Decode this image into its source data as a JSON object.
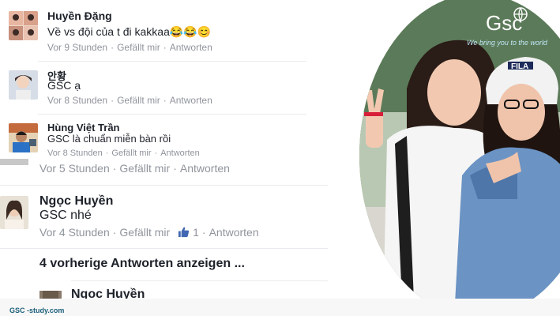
{
  "comments": [
    {
      "name": "Huyền Đặng",
      "text": "Về vs đội của t đi kakkaa",
      "emoji": "😂😂😊",
      "time": "Vor 9 Stunden",
      "like": "Gefällt mir",
      "reply": "Antworten"
    },
    {
      "name": "안황",
      "text": "GSC ạ",
      "time": "Vor 8 Stunden",
      "like": "Gefällt mir",
      "reply": "Antworten"
    },
    {
      "name": "Hùng Việt Trần",
      "text": "GSC là chuẩn miễn bàn rồi",
      "time": "Vor 8 Stunden",
      "like": "Gefällt mir",
      "reply": "Antworten"
    }
  ],
  "parent_meta": {
    "time": "Vor 5 Stunden",
    "like": "Gefällt mir",
    "reply": "Antworten"
  },
  "main_comment": {
    "name": "Ngọc Huyền",
    "text": "GSC nhé",
    "time": "Vor 4 Stunden",
    "like": "Gefällt mir",
    "like_count": "1",
    "reply": "Antworten"
  },
  "show_previous": "4 vorherige Antworten anzeigen ...",
  "cut_comment_name": "Ngọc Huyền",
  "brand": {
    "logo": "Gsc",
    "slogan": "We bring you to the world",
    "shirt_text": "FILA"
  },
  "footer": "GSC -study.com",
  "colors": {
    "name": "#1d2129",
    "meta": "#90949c",
    "like_blue": "#4267b2",
    "brand_blue": "#1aa3d9"
  }
}
